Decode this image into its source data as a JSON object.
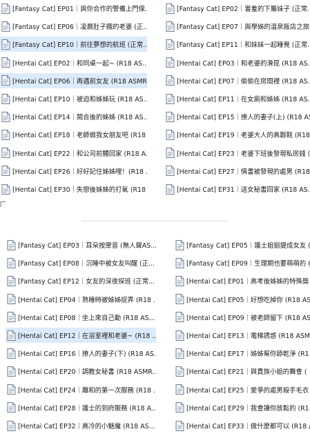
{
  "file_icon": "text-document-icon",
  "top_panel": {
    "items": [
      {
        "label": "[Fantasy Cat] EP01｜與你合作的警備上門保...",
        "selected": false
      },
      {
        "label": "[Fantasy Cat] EP02｜害羞的下屬妹子 (正常...",
        "selected": false
      },
      {
        "label": "[Fantasy Cat] EP06｜凌晨肚子餓的老婆 (正...",
        "selected": false
      },
      {
        "label": "[Fantasy Cat] EP07｜與學姊的溫泉飯店之旅 ...",
        "selected": false
      },
      {
        "label": "[Fantasy Cat] EP10｜前往夢想的航班 (正常...",
        "selected": true
      },
      {
        "label": "[Fantasy Cat] EP11｜和妹妹一起睡覺 (正常...",
        "selected": false
      },
      {
        "label": "[Hentai Cat] EP02｜和同桌一起~ (R18 AS...",
        "selected": false
      },
      {
        "label": "[Hentai Cat] EP03｜和老婆的滑昆 (R18 AS...",
        "selected": false
      },
      {
        "label": "[Hentai Cat] EP06｜再遇前女友 (R18 ASMR...",
        "selected": true
      },
      {
        "label": "[Hentai Cat] EP07｜偷偷在房間裡 (R18 AS...",
        "selected": false
      },
      {
        "label": "[Hentai Cat] EP10｜被迫和姊姊玩 (R18 AS...",
        "selected": false
      },
      {
        "label": "[Hentai Cat] EP11｜在女廁和姊姊 (R18 AS...",
        "selected": false
      },
      {
        "label": "[Hentai Cat] EP14｜鬧合後的姊姊 (R18 AS...",
        "selected": false
      },
      {
        "label": "[Hentai Cat] EP15｜撩人的妻子(上) (R18 AS...",
        "selected": false
      },
      {
        "label": "[Hentai Cat] EP18｜老師做我女朋友吧 (R18 ...",
        "selected": false
      },
      {
        "label": "[Hentai Cat] EP19｜老婆大人的高跟鞋 (R18 ...",
        "selected": false
      },
      {
        "label": "[Hentai Cat] EP22｜和公司前體回家 (R18 A...",
        "selected": false
      },
      {
        "label": "[Hentai Cat] EP23｜老婆下班後發現私房錢 (...",
        "selected": false
      },
      {
        "label": "[Hentai Cat] EP26｜好好記住姊姊哩！(R18 ...",
        "selected": false
      },
      {
        "label": "[Hentai Cat] EP27｜情書被發現的處男 (R18 ...",
        "selected": false
      },
      {
        "label": "[Hentai Cat] EP30｜失戀後姊姊的打氣 (R18 ...",
        "selected": false
      },
      {
        "label": "[Hentai Cat] EP31｜送女秘書回家 (R18 AS...",
        "selected": false
      }
    ]
  },
  "bottom_panel": {
    "items": [
      {
        "label": "[Fantasy Cat] EP03｜耳朵按摩音 (無人聲AS...",
        "selected": false
      },
      {
        "label": "[Fantasy Cat] EP05｜護士姐姐變成女友 (",
        "selected": false
      },
      {
        "label": "[Fantasy Cat] EP08｜沉睡中被女友叫醒 (正...",
        "selected": false
      },
      {
        "label": "[Fantasy Cat] EP09｜生理期也要萌萌的 (",
        "selected": false
      },
      {
        "label": "[Fantasy Cat] EP12｜女友的深夜探班 (正常...",
        "selected": false
      },
      {
        "label": "[Hentai Cat] EP01｜高考後姊姊的特殊獎",
        "selected": false
      },
      {
        "label": "[Hentai Cat] EP04｜熟睡時被姊姊捉弄 (R18 ...",
        "selected": false
      },
      {
        "label": "[Hentai Cat] EP05｜好想吃掉你 (R18 AS",
        "selected": false
      },
      {
        "label": "[Hentai Cat] EP08｜坐上來自己動 (R18 AS...",
        "selected": false
      },
      {
        "label": "[Hentai Cat] EP09｜被老師留下 (R18 AS",
        "selected": false
      },
      {
        "label": "[Hentai Cat] EP12｜在浴室裡和老婆~ (R18 ...",
        "selected": true
      },
      {
        "label": "[Hentai Cat] EP13｜電梯誘惑 (R18 ASM",
        "selected": false
      },
      {
        "label": "[Hentai Cat] EP16｜撩人的妻子(下) (R18 AS...",
        "selected": false
      },
      {
        "label": "[Hentai Cat] EP17｜姊姊幫你舔乾淨 (R1",
        "selected": false
      },
      {
        "label": "[Hentai Cat] EP20｜調教女秘書 (R18 ASMR...",
        "selected": false
      },
      {
        "label": "[Hentai Cat] EP21｜與貴族小姐的舞會 (",
        "selected": false
      },
      {
        "label": "[Hentai Cat] EP24｜離和的第一次服務 (R18 ...",
        "selected": false
      },
      {
        "label": "[Hentai Cat] EP25｜愛爭的處男殺手毛衣",
        "selected": false
      },
      {
        "label": "[Hentai Cat] EP28｜護士的到府服務 (R18 A...",
        "selected": false
      },
      {
        "label": "[Hentai Cat] EP29｜我會讓你放鬆的 (R1",
        "selected": false
      },
      {
        "label": "[Hentai Cat] EP32｜高冷的小魅魔 (R18 AS...",
        "selected": false
      },
      {
        "label": "[Hentai Cat] EP33｜做什麼都可以 (R18 /",
        "selected": false
      }
    ]
  }
}
